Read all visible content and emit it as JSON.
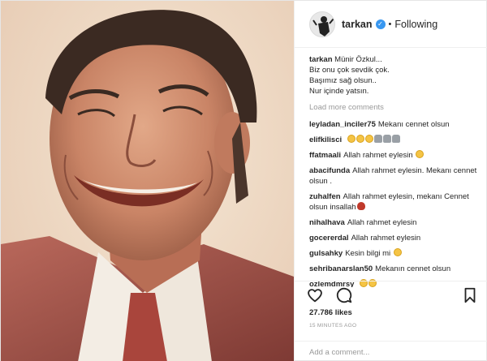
{
  "header": {
    "username": "tarkan",
    "separator": "•",
    "follow_status": "Following"
  },
  "caption": {
    "username": "tarkan",
    "lines": [
      "Münir Özkul...",
      "Biz onu çok sevdik çok.",
      "Başımız sağ olsun..",
      "Nur içinde yatsın."
    ]
  },
  "load_more": "Load more comments",
  "comments": [
    {
      "user": "leyladan_inciler75",
      "text": "Mekanı cennet olsun",
      "emoji": []
    },
    {
      "user": "elifkilisci",
      "text": "",
      "emoji": [
        "cry-face",
        "cry-face",
        "cry-face",
        "pray",
        "pray",
        "pray"
      ]
    },
    {
      "user": "ffatmaali",
      "text": "Allah rahmet eylesin",
      "emoji": [
        "sad-face"
      ]
    },
    {
      "user": "abacifunda",
      "text": "Allah rahmet eylesin. Mekanı cennet olsun .",
      "emoji": []
    },
    {
      "user": "zuhalfen",
      "text": "Allah rahmet eylesin, mekanı Cennet olsun insallah",
      "emoji": [
        "rose"
      ]
    },
    {
      "user": "nihalhava",
      "text": "Allah rahmet eylesin",
      "emoji": []
    },
    {
      "user": "gocererdal",
      "text": "Allah rahmet eylesin",
      "emoji": []
    },
    {
      "user": "gulsahky",
      "text": "Kesin bilgi mi",
      "emoji": [
        "sad-face"
      ]
    },
    {
      "user": "sehribanarslan50",
      "text": "Mekanın cennet olsun",
      "emoji": []
    },
    {
      "user": "ozlemdmrsy",
      "text": "",
      "emoji": [
        "sad-face",
        "sad-face"
      ]
    }
  ],
  "likes": "27.786 likes",
  "timestamp": "15 MINUTES AGO",
  "add_comment_placeholder": "Add a comment...",
  "colors": {
    "verified": "#3897f0",
    "muted": "#999999",
    "text": "#262626"
  },
  "icons": [
    "heart-icon",
    "comment-icon",
    "bookmark-icon",
    "verified-badge-icon"
  ]
}
